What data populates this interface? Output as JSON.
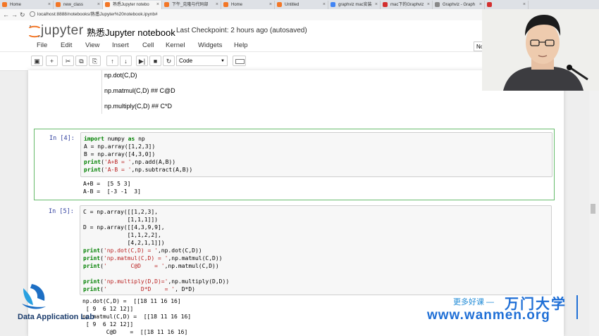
{
  "browser": {
    "tabs": [
      {
        "label": "Home",
        "color": "#f37626"
      },
      {
        "label": "new_class",
        "color": "#f37626"
      },
      {
        "label": "熟悉Jupyter notebo",
        "color": "#f37626"
      },
      {
        "label": "下午_克隆与代码部",
        "color": "#f37626"
      },
      {
        "label": "Home",
        "color": "#f37626"
      },
      {
        "label": "Untitled",
        "color": "#f37626"
      },
      {
        "label": "graphviz mac安装",
        "color": "#4285f4"
      },
      {
        "label": "mac下的Graphviz",
        "color": "#d32f2f"
      },
      {
        "label": "Graphviz - Graph",
        "color": "#888888"
      },
      {
        "label": "",
        "color": "#d32f2f"
      }
    ],
    "url": "localhost:8888/notebooks/熟悉Jupyter%20notebook.ipynb#"
  },
  "header": {
    "logo_text": "jupyter",
    "title": "熟悉Jupyter notebook",
    "checkpoint": "Last Checkpoint: 2 hours ago (autosaved)",
    "right_button": "No"
  },
  "menu": [
    "File",
    "Edit",
    "View",
    "Insert",
    "Cell",
    "Kernel",
    "Widgets",
    "Help"
  ],
  "toolbar": {
    "cell_type": "Code"
  },
  "markdown_lines": [
    "np.dot(C,D)",
    "np.matmul(C,D) ## C@D",
    "np.multiply(C,D) ## C*D"
  ],
  "cells": [
    {
      "prompt": "In  [4]:",
      "source": "import numpy as np\nA = np.array([1,2,3])\nB = np.array([4,3,0])\nprint('A+B = ',np.add(A,B))\nprint('A-B = ',np.subtract(A,B))",
      "output": "A+B =  [5 5 3]\nA-B =  [-3 -1  3]"
    },
    {
      "prompt": "In  [5]:",
      "source": "C = np.array([[1,2,3],\n             [1,1,1]])\nD = np.array([[4,3,9,9],\n             [1,1,2,2],\n             [4,2,1,1]])\nprint('np.dot(C,D) = ',np.dot(C,D))\nprint('np.matmul(C,D) = ',np.matmul(C,D))\nprint('       C@D    = ',np.matmul(C,D))\n\nprint('np.multiply(D,D)=',np.multiply(D,D))\nprint('          D*D    = ', D*D)",
      "output": "np.dot(C,D) =  [[18 11 16 16]\n [ 9  6 12 12]]\nnp.matmul(C,D) =  [[18 11 16 16]\n [ 9  6 12 12]]\n       C@D    =  [[18 11 16 16]"
    }
  ],
  "watermark": {
    "org": "Data Application Lab",
    "slogan": "更多好课 —",
    "brand": "万门大学",
    "site": "www.wanmen.org"
  }
}
